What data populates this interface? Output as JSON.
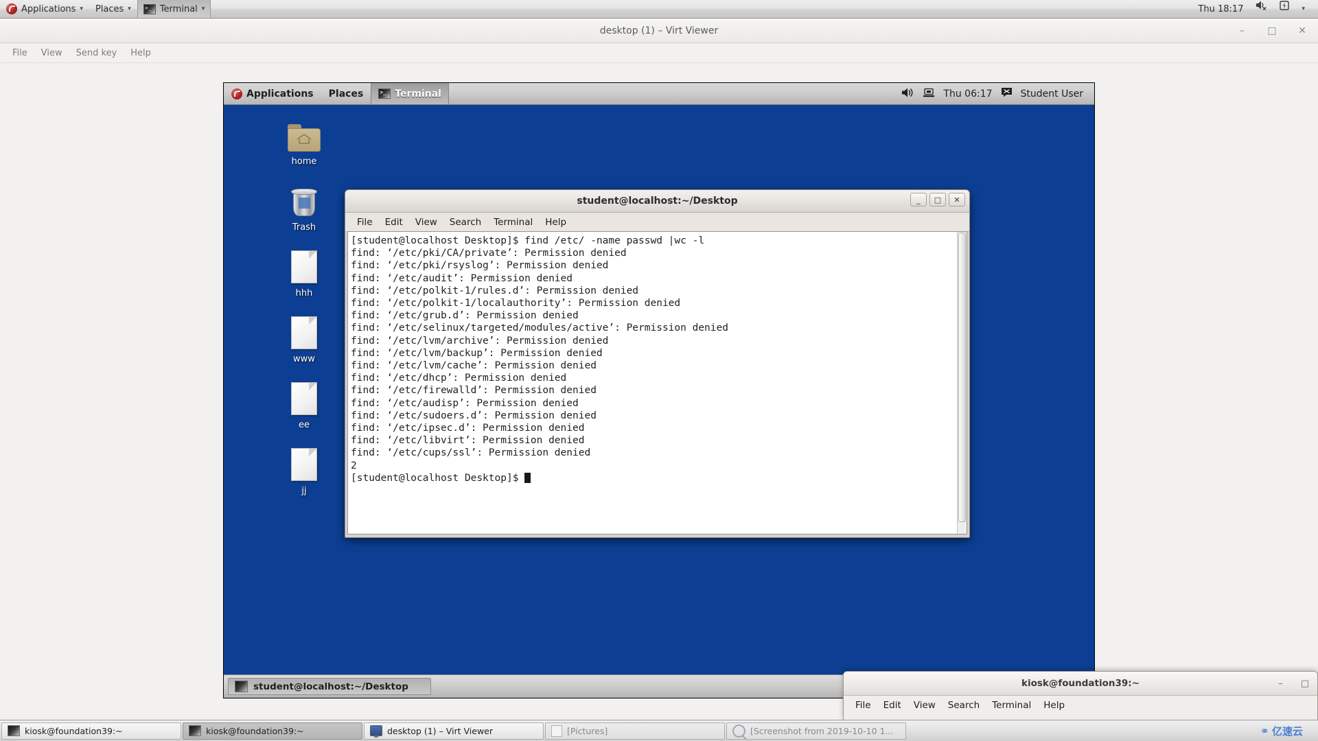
{
  "host_panel": {
    "logo_icon": "fedora-logo-icon",
    "applications_label": "Applications",
    "places_label": "Places",
    "terminal_label": "Terminal",
    "caret": "▾",
    "clock": "Thu 18:17",
    "volume_icon": "volume-muted-icon",
    "battery_icon": "battery-charging-icon",
    "menu_caret": "▾"
  },
  "virt_viewer": {
    "title": "desktop (1) – Virt Viewer",
    "window_buttons": {
      "minimize": "–",
      "maximize": "□",
      "close": "✕"
    },
    "menu": [
      "File",
      "View",
      "Send key",
      "Help"
    ]
  },
  "guest": {
    "panel": {
      "logo_icon": "fedora-logo-icon",
      "applications_label": "Applications",
      "places_label": "Places",
      "terminal_label": "Terminal",
      "volume_icon": "volume-icon",
      "network_icon": "network-icon",
      "clock": "Thu 06:17",
      "user_icon": "chat-bubble-icon",
      "user_label": "Student User"
    },
    "desktop_icons": [
      {
        "label": "home",
        "icon": "home-folder-icon",
        "type": "folder"
      },
      {
        "label": "Trash",
        "icon": "trash-icon",
        "type": "trash"
      },
      {
        "label": "hhh",
        "icon": "text-file-icon",
        "type": "file"
      },
      {
        "label": "www",
        "icon": "text-file-icon",
        "type": "file"
      },
      {
        "label": "ee",
        "icon": "text-file-icon",
        "type": "file"
      },
      {
        "label": "jj",
        "icon": "text-file-icon",
        "type": "file"
      }
    ],
    "terminal": {
      "title": "student@localhost:~/Desktop",
      "window_buttons": {
        "minimize": "_",
        "maximize": "□",
        "close": "✕"
      },
      "menu": [
        "File",
        "Edit",
        "View",
        "Search",
        "Terminal",
        "Help"
      ],
      "content": "[student@localhost Desktop]$ find /etc/ -name passwd |wc -l\nfind: ‘/etc/pki/CA/private’: Permission denied\nfind: ‘/etc/pki/rsyslog’: Permission denied\nfind: ‘/etc/audit’: Permission denied\nfind: ‘/etc/polkit-1/rules.d’: Permission denied\nfind: ‘/etc/polkit-1/localauthority’: Permission denied\nfind: ‘/etc/grub.d’: Permission denied\nfind: ‘/etc/selinux/targeted/modules/active’: Permission denied\nfind: ‘/etc/lvm/archive’: Permission denied\nfind: ‘/etc/lvm/backup’: Permission denied\nfind: ‘/etc/lvm/cache’: Permission denied\nfind: ‘/etc/dhcp’: Permission denied\nfind: ‘/etc/firewalld’: Permission denied\nfind: ‘/etc/audisp’: Permission denied\nfind: ‘/etc/sudoers.d’: Permission denied\nfind: ‘/etc/ipsec.d’: Permission denied\nfind: ‘/etc/libvirt’: Permission denied\nfind: ‘/etc/cups/ssl’: Permission denied\n2\n[student@localhost Desktop]$ ",
      "command": "find /etc/ -name passwd |wc -l",
      "result_count": "2",
      "prompt": "[student@localhost Desktop]$"
    },
    "taskbar": {
      "task_label": "student@localhost:~/Desktop",
      "task_icon": "terminal-icon"
    }
  },
  "kiosk_terminal": {
    "title": "kiosk@foundation39:~",
    "window_buttons": {
      "minimize": "–",
      "maximize": "□"
    },
    "menu": [
      "File",
      "Edit",
      "View",
      "Search",
      "Terminal",
      "Help"
    ]
  },
  "host_taskbar": {
    "tasks": [
      {
        "label": "kiosk@foundation39:~",
        "icon": "terminal-icon",
        "state": "normal"
      },
      {
        "label": "kiosk@foundation39:~",
        "icon": "terminal-icon",
        "state": "active"
      },
      {
        "label": "desktop (1) – Virt Viewer",
        "icon": "monitor-icon",
        "state": "normal"
      },
      {
        "label": "[Pictures]",
        "icon": "image-icon",
        "state": "minimized"
      },
      {
        "label": "[Screenshot from 2019-10-10 1...",
        "icon": "screenshot-icon",
        "state": "minimized"
      }
    ],
    "watermark": "亿速云",
    "watermark_icon": "cloud-logo-icon"
  },
  "colors": {
    "desktop_blue": "#0c3f94",
    "panel_grey": "#cfcfcf",
    "terminal_bg": "#ffffff",
    "terminal_fg": "#222222",
    "watermark_blue": "#4a7fd4"
  }
}
